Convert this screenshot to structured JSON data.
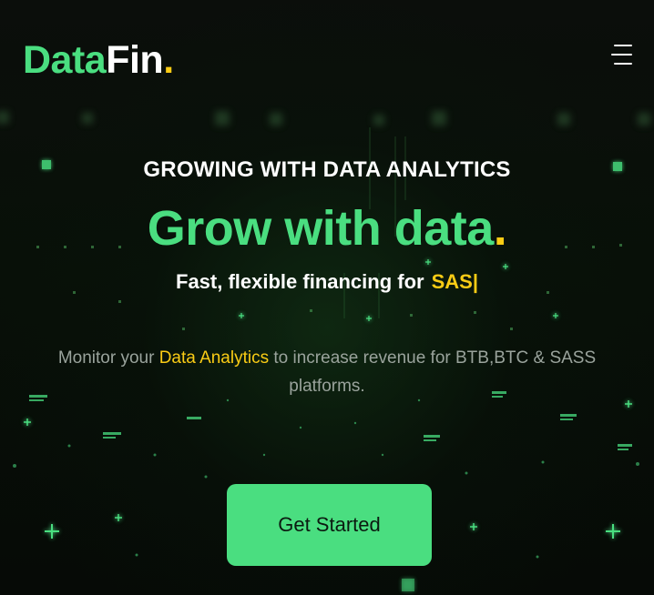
{
  "header": {
    "logo_part_a": "Data",
    "logo_part_b": "Fin",
    "logo_dot": ".",
    "menu_icon": "hamburger-menu-icon"
  },
  "hero": {
    "eyebrow": "GROWING WITH DATA ANALYTICS",
    "headline": "Grow with data",
    "headline_dot": ".",
    "tagline": "Fast, flexible financing for",
    "typed_text": "SAS|",
    "description_before": "Monitor your ",
    "description_highlight": "Data Analytics",
    "description_after": " to increase revenue for BTB,BTC & SASS platforms.",
    "cta_label": "Get Started"
  },
  "colors": {
    "accent_green": "#4ade80",
    "accent_yellow": "#facc15",
    "background": "#070a07",
    "text_white": "#ffffff",
    "text_muted": "#9aa39c"
  }
}
